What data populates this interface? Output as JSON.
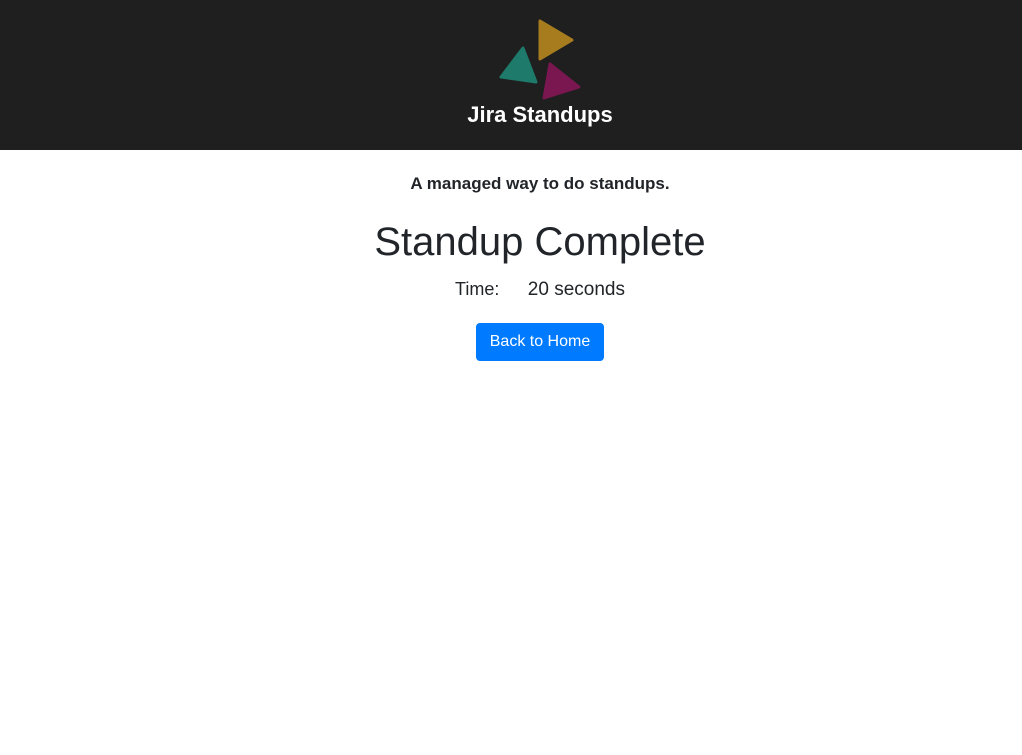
{
  "header": {
    "app_title": "Jira Standups",
    "logo_icon": "triangles-logo-icon",
    "logo_colors": [
      "#a67c1f",
      "#1e7a6a",
      "#7a1650"
    ]
  },
  "main": {
    "tagline": "A managed way to do standups.",
    "title": "Standup Complete",
    "time_label": "Time:",
    "time_value": "20 seconds",
    "back_button_label": "Back to Home"
  },
  "colors": {
    "header_bg": "#1f1f1f",
    "primary": "#007bff",
    "text": "#212529"
  }
}
